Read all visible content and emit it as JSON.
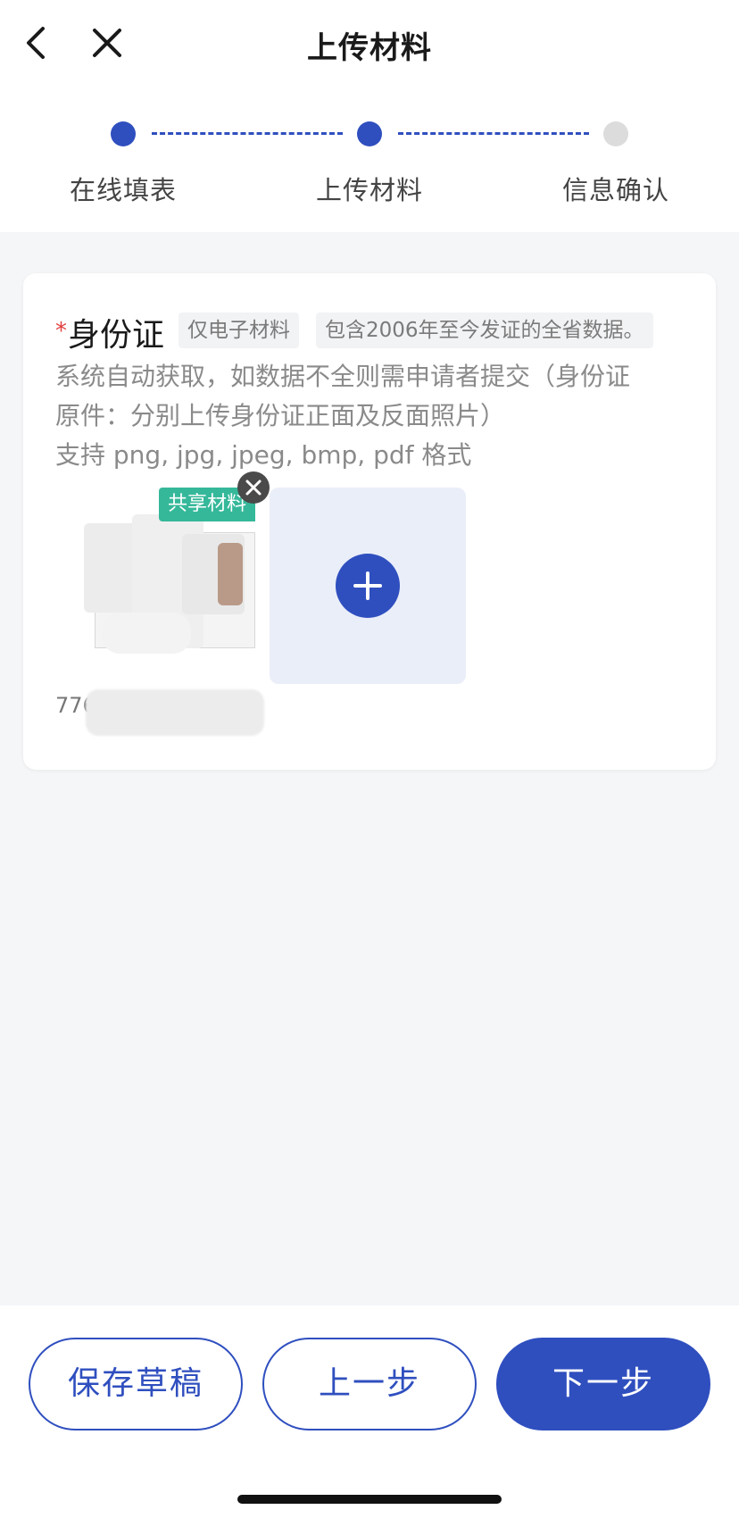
{
  "header": {
    "title": "上传材料",
    "back_icon": "chevron-left-icon",
    "close_icon": "close-icon"
  },
  "steps": [
    {
      "label": "在线填表",
      "state": "done"
    },
    {
      "label": "上传材料",
      "state": "active"
    },
    {
      "label": "信息确认",
      "state": "pending"
    }
  ],
  "material": {
    "required_mark": "*",
    "title": "身份证",
    "tag_electronic": "仅电子材料",
    "tag_scope": "包含2006年至今发证的全省数据。",
    "desc_line1": "系统自动获取，如数据不全则需申请者提交（身份证",
    "desc_line2": "原件：分别上传身份证正面及反面照片）",
    "formats": "支持 png, jpg, jpeg, bmp, pdf 格式",
    "file": {
      "badge": "共享材料",
      "name_visible": "776"
    }
  },
  "buttons": {
    "save_draft": "保存草稿",
    "previous": "上一步",
    "next": "下一步"
  },
  "colors": {
    "primary": "#2f4fbf",
    "badge": "#35b89a",
    "required": "#e24040"
  }
}
